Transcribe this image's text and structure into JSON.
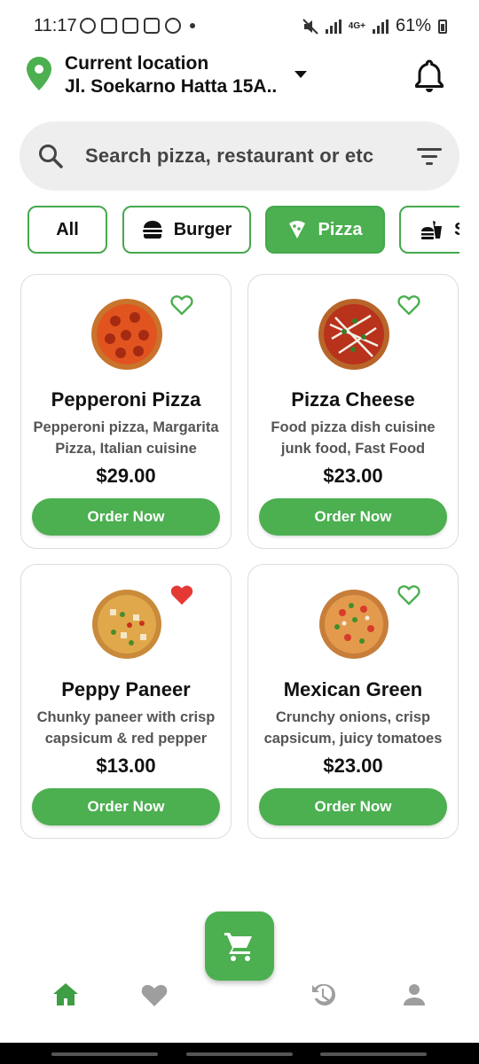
{
  "status_bar": {
    "time": "11:17",
    "battery": "61%",
    "network": "4G+"
  },
  "header": {
    "location_title": "Current location",
    "location_address": "Jl. Soekarno Hatta 15A.."
  },
  "search": {
    "placeholder": "Search pizza, restaurant or etc"
  },
  "categories": [
    {
      "label": "All",
      "icon": "none",
      "active": false
    },
    {
      "label": "Burger",
      "icon": "burger-icon",
      "active": false
    },
    {
      "label": "Pizza",
      "icon": "pizza-slice-icon",
      "active": true
    },
    {
      "label": "S",
      "icon": "fast-food-icon",
      "active": false
    }
  ],
  "products": [
    {
      "name": "Pepperoni Pizza",
      "desc_line1": "Pepperoni pizza, Margarita",
      "desc_line2": "Pizza, Italian cuisine",
      "price": "$29.00",
      "favorite": false,
      "button": "Order Now"
    },
    {
      "name": "Pizza Cheese",
      "desc_line1": "Food pizza dish cuisine",
      "desc_line2": "junk food, Fast Food",
      "price": "$23.00",
      "favorite": false,
      "button": "Order Now"
    },
    {
      "name": "Peppy Paneer",
      "desc_line1": "Chunky paneer with crisp",
      "desc_line2": "capsicum & red pepper",
      "price": "$13.00",
      "favorite": true,
      "button": "Order Now"
    },
    {
      "name": "Mexican Green",
      "desc_line1": "Crunchy onions, crisp",
      "desc_line2": "capsicum, juicy tomatoes",
      "price": "$23.00",
      "favorite": false,
      "button": "Order Now"
    }
  ],
  "bottom_nav": [
    "home-icon",
    "favorites-icon",
    "cart-icon",
    "history-icon",
    "profile-icon"
  ],
  "colors": {
    "accent": "#4caf50",
    "favorite": "#e53935",
    "search_bg": "#eeeeee"
  }
}
